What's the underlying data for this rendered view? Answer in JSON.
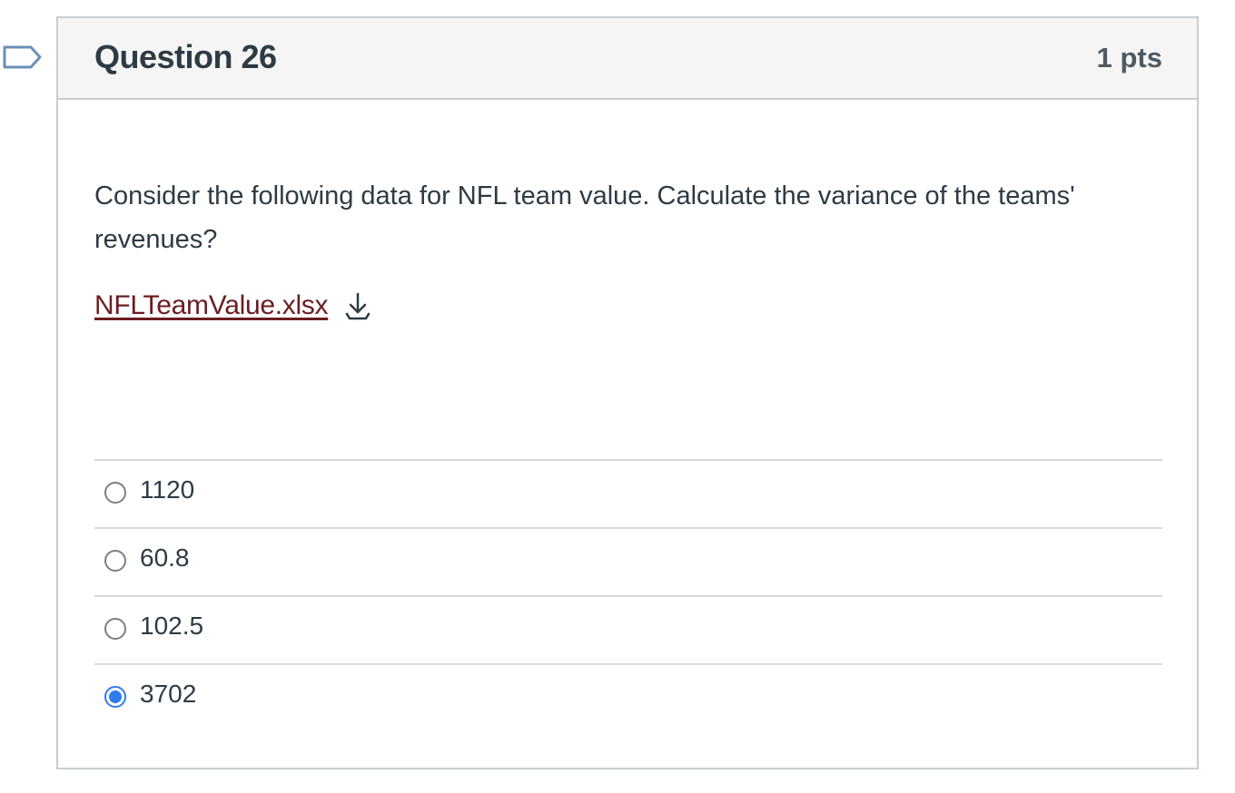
{
  "question": {
    "title": "Question 26",
    "points": "1 pts",
    "text": "Consider the following data for NFL team value.  Calculate the variance of the teams' revenues?",
    "attachment": {
      "filename": "NFLTeamValue.xlsx",
      "icon": "download-icon"
    }
  },
  "answers": [
    {
      "label": "1120",
      "selected": false
    },
    {
      "label": "60.8",
      "selected": false
    },
    {
      "label": "102.5",
      "selected": false
    },
    {
      "label": "3702",
      "selected": true
    }
  ],
  "colors": {
    "link": "#6b1d22",
    "accent": "#2f7bf0",
    "border": "#c7cdd1",
    "header_bg": "#f5f5f5"
  }
}
